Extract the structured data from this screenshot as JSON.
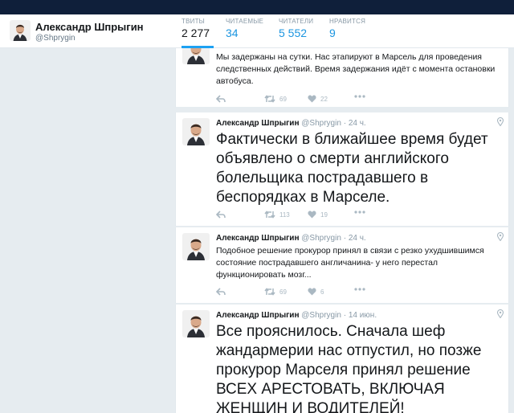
{
  "profile": {
    "name": "Александр Шпрыгин",
    "handle": "@Shprygin"
  },
  "stats": [
    {
      "label": "ТВИТЫ",
      "value": "2 277"
    },
    {
      "label": "ЧИТАЕМЫЕ",
      "value": "34"
    },
    {
      "label": "ЧИТАТЕЛИ",
      "value": "5 552"
    },
    {
      "label": "НРАВИТСЯ",
      "value": "9"
    }
  ],
  "tweets": [
    {
      "text": "Мы задержаны на сутки. Нас этапируют в Марсель для проведения следственных действий. Время задержания идёт с момента остановки автобуса.",
      "retweets": "69",
      "likes": "22"
    },
    {
      "name": "Александр Шпрыгин",
      "handle": "@Shprygin",
      "time": "24 ч.",
      "text": "Фактически в ближайшее время будет объявлено о смерти английского болельщика пострадавшего в беспорядках в Марселе.",
      "retweets": "113",
      "likes": "19"
    },
    {
      "name": "Александр Шпрыгин",
      "handle": "@Shprygin",
      "time": "24 ч.",
      "text": "Подобное решение прокурор принял в связи с резко ухудшившимся состояние пострадавшего англичанина- у него перестал функционировать мозг...",
      "retweets": "69",
      "likes": "6"
    },
    {
      "name": "Александр Шпрыгин",
      "handle": "@Shprygin",
      "time": "14 июн.",
      "text": "Все прояснилось. Сначала шеф жандармерии нас отпустил, но позже прокурор Марселя принял решение ВСЕХ АРЕСТОВАТЬ, ВКЛЮЧАЯ ЖЕНЩИН И ВОДИТЕЛЕЙ!"
    }
  ],
  "icons": {
    "reply": "reply-icon",
    "retweet": "retweet-icon",
    "like": "heart-icon",
    "more": "more-icon",
    "location": "location-pin-icon"
  },
  "colors": {
    "topbar": "#0f1f3a",
    "accent": "#1da1f2",
    "background": "#e6ecf0"
  }
}
